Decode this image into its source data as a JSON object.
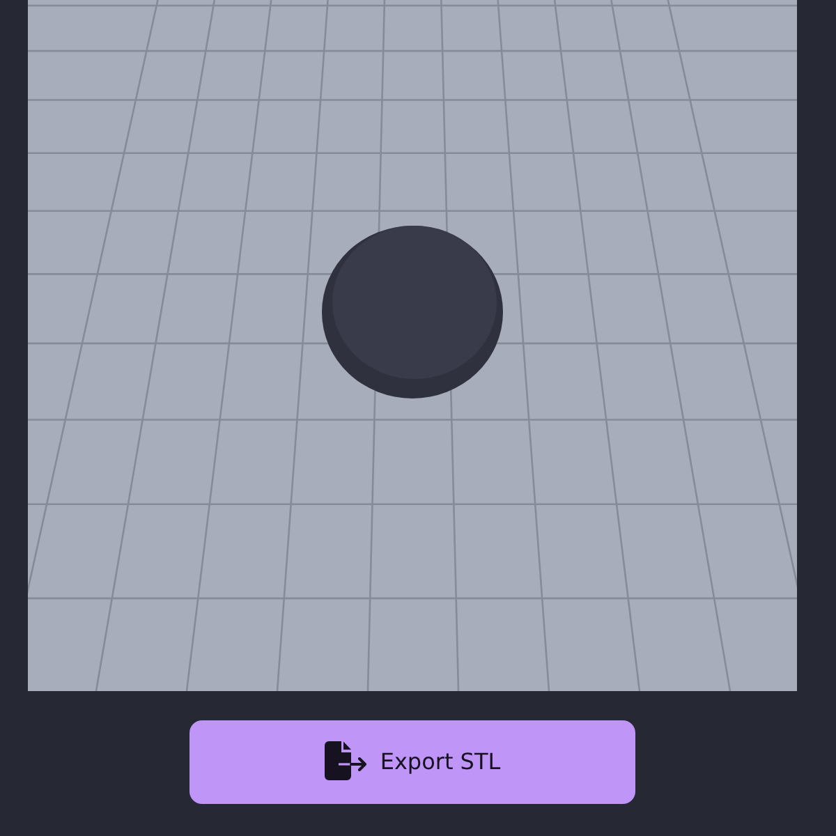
{
  "export_button": {
    "label": "Export STL"
  }
}
